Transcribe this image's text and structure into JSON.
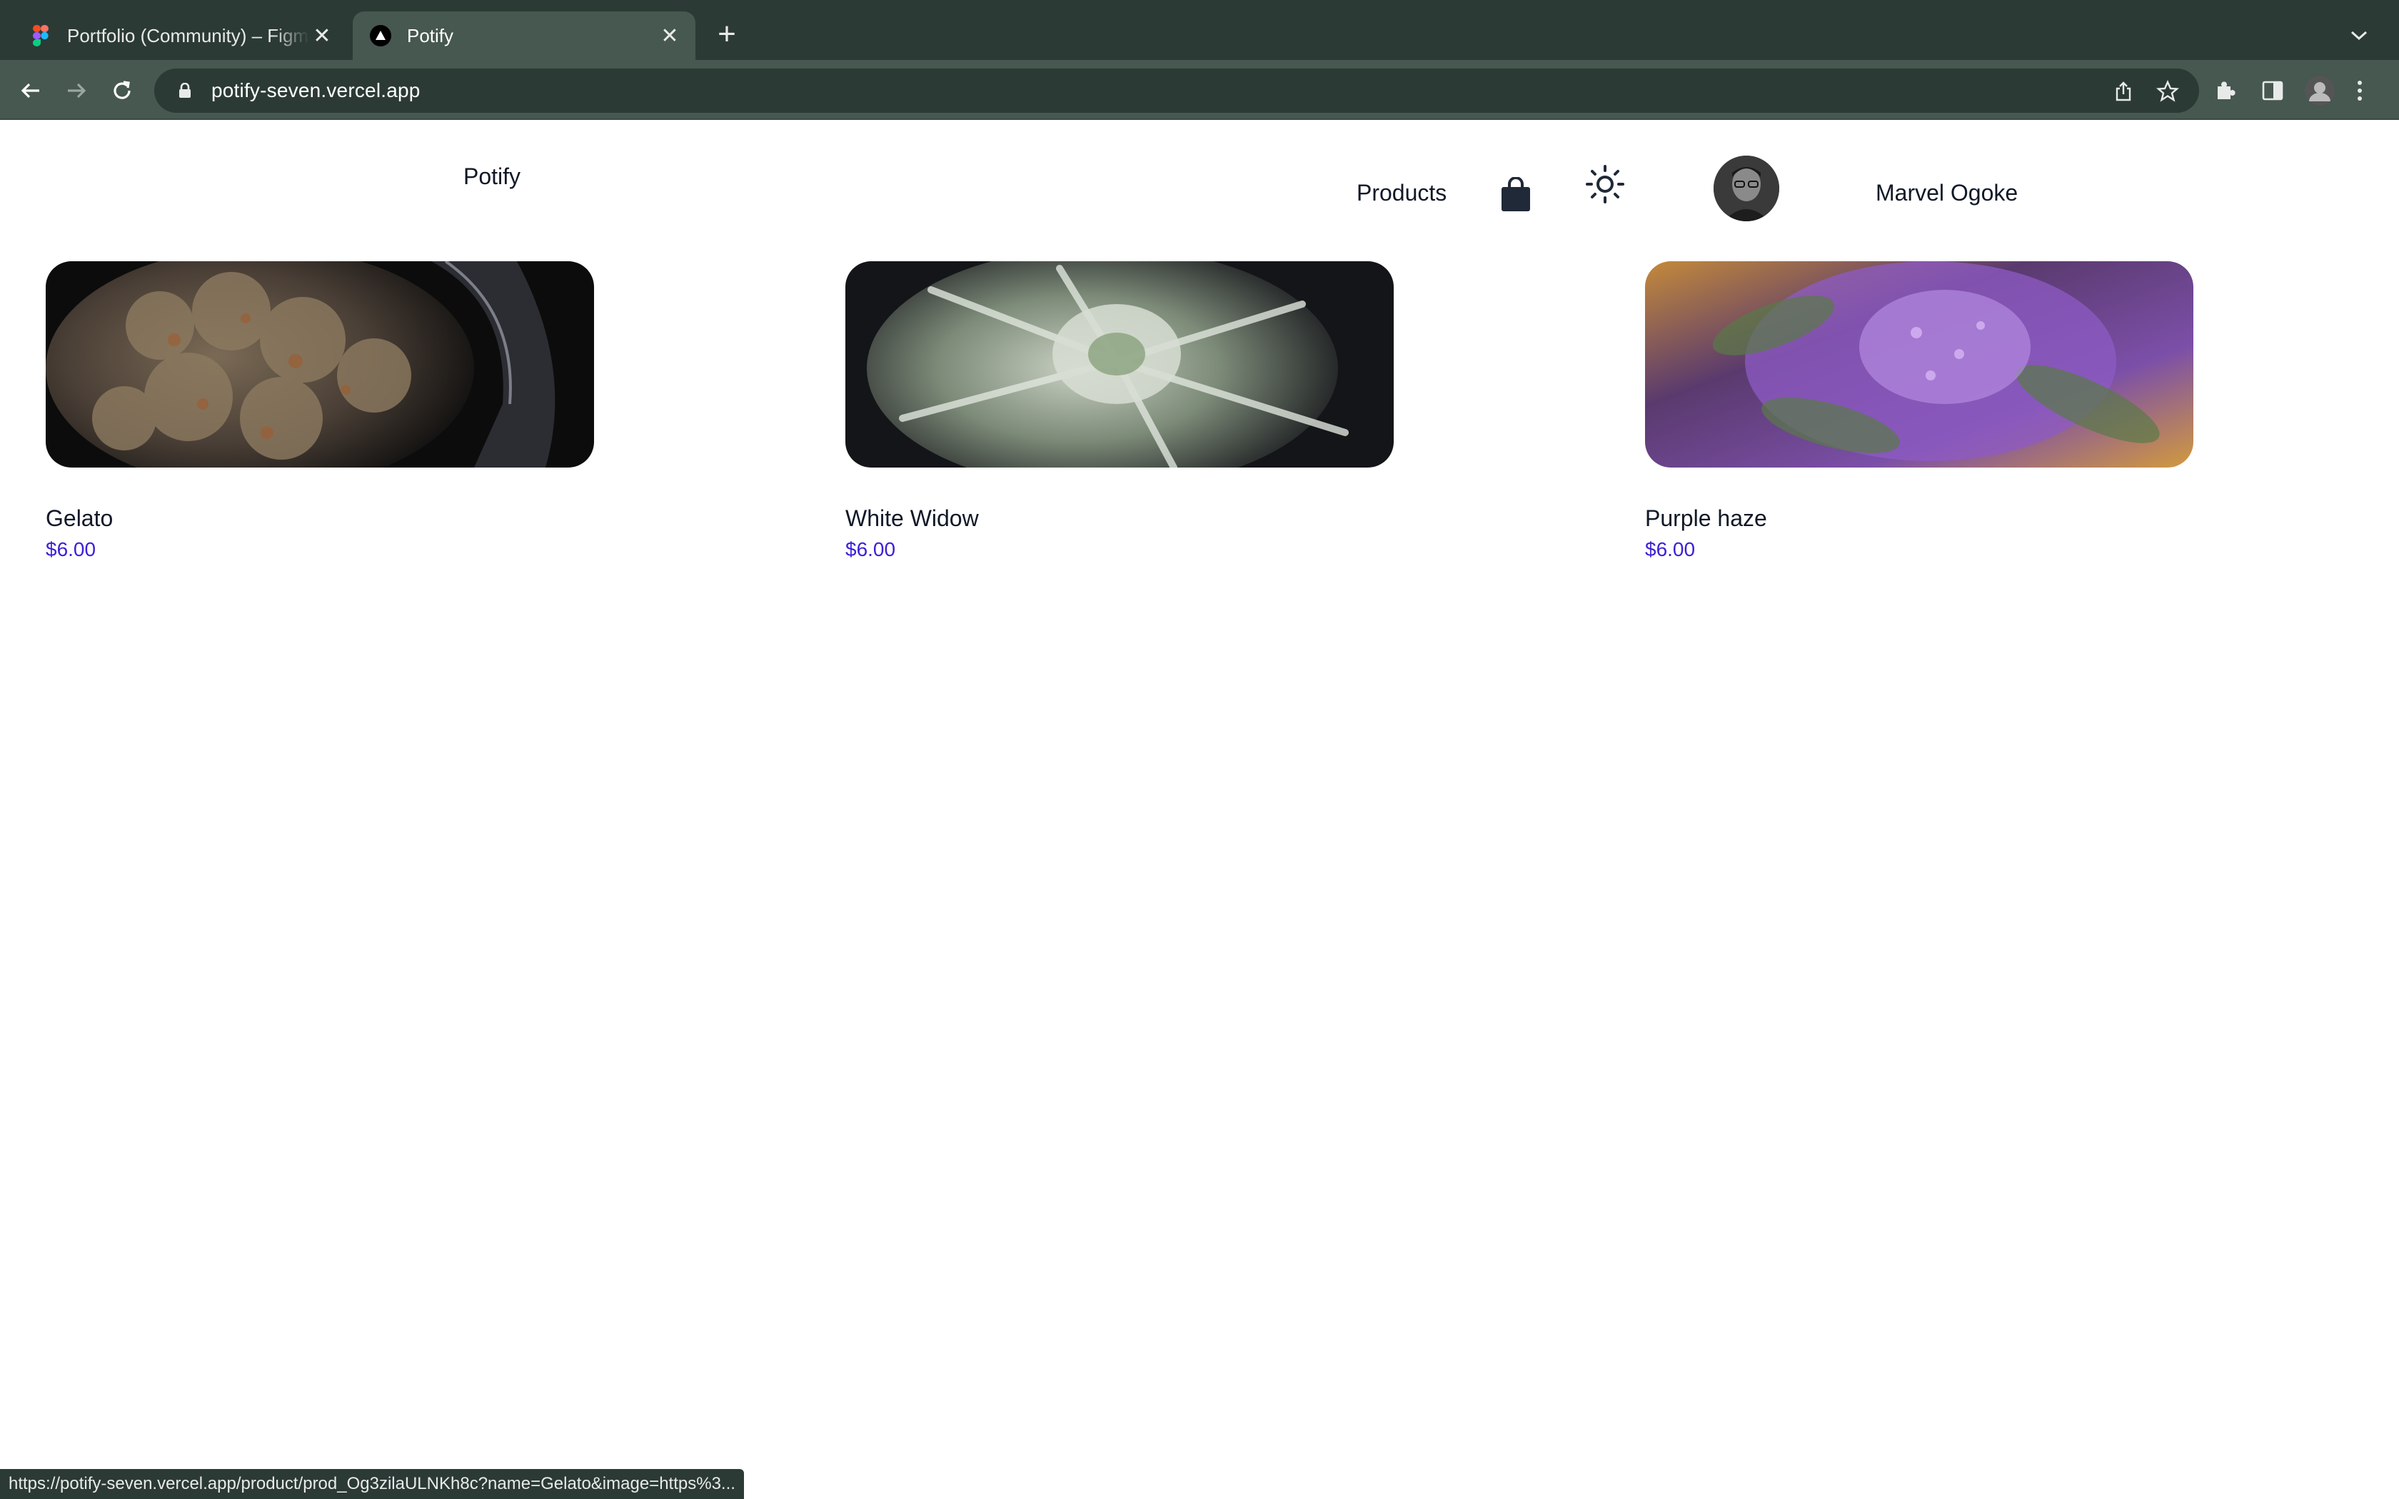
{
  "browser": {
    "tabs": [
      {
        "title": "Portfolio (Community) – Figma",
        "favicon": "figma-icon",
        "active": false
      },
      {
        "title": "Potify",
        "favicon": "vercel-icon",
        "active": true
      }
    ],
    "url": "potify-seven.vercel.app",
    "status_url": "https://potify-seven.vercel.app/product/prod_Og3zilaULNKh8c?name=Gelato&image=https%3..."
  },
  "header": {
    "brand": "Potify",
    "nav_products": "Products",
    "cart_icon": "shopping-bag-icon",
    "theme_icon": "sun-icon",
    "user_name": "Marvel Ogoke"
  },
  "products": [
    {
      "name": "Gelato",
      "price": "$6.00"
    },
    {
      "name": "White Widow",
      "price": "$6.00"
    },
    {
      "name": "Purple haze",
      "price": "$6.00"
    }
  ],
  "colors": {
    "chrome_dark": "#2c3a36",
    "chrome_toolbar": "#46584f",
    "price": "#3b21d6",
    "text": "#111827"
  }
}
